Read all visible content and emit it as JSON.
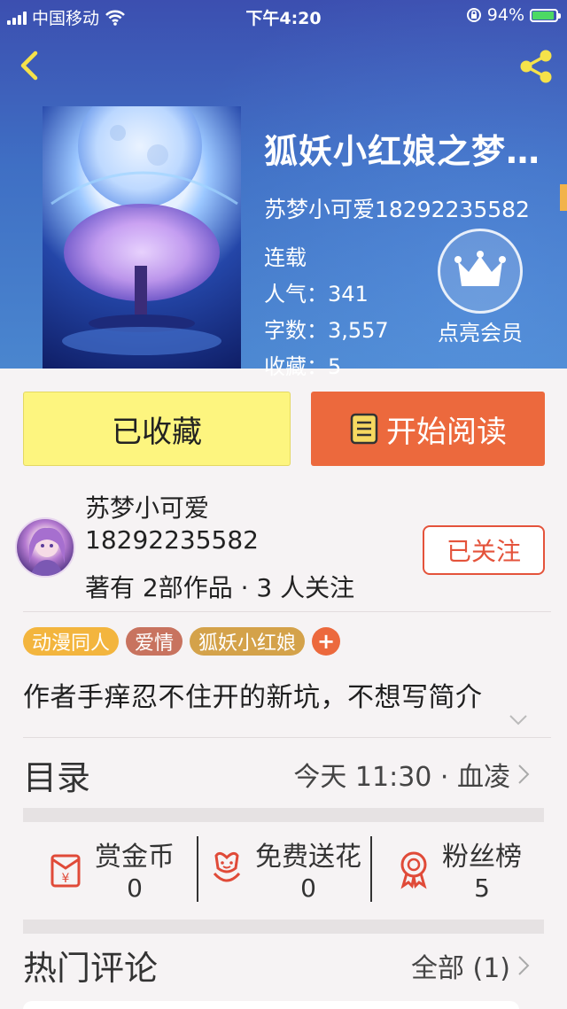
{
  "status_bar": {
    "carrier": "中国移动",
    "time": "下午4:20",
    "battery": "94%",
    "icons": [
      "signal-bars-icon",
      "wifi-icon",
      "orientation-lock-icon",
      "battery-charging-icon"
    ]
  },
  "header": {
    "back_icon": "chevron-left-icon",
    "share_icon": "share-icon",
    "accent": "#f2b34a"
  },
  "book": {
    "title": "狐妖小红娘之梦…",
    "author": "苏梦小可爱18292235582",
    "status": "连载",
    "popularity": "人气：341",
    "word_count": "字数：3,557",
    "favorites": "收藏：5"
  },
  "member": {
    "icon": "crown-icon",
    "label": "点亮会员"
  },
  "actions": {
    "favorited_label": "已收藏",
    "read_label": "开始阅读",
    "read_icon": "book-icon",
    "read_color": "#ec693d",
    "favorited_color": "#fdf57f"
  },
  "author_row": {
    "name_line1": "苏梦小可爱",
    "name_line2": "18292235582",
    "stats": "著有 2部作品 · 3 人关注",
    "follow_label": "已关注"
  },
  "tags": [
    {
      "label": "动漫同人",
      "color": "#f3b53e"
    },
    {
      "label": "爱情",
      "color": "#c8735f"
    },
    {
      "label": "狐妖小红娘",
      "color": "#d4a24a"
    }
  ],
  "tag_add": "+",
  "intro": "作者手痒忍不住开的新坑，不想写简介",
  "catalog": {
    "title": "目录",
    "latest": "今天 11:30 · 血凌"
  },
  "stats": [
    {
      "label": "赏金币",
      "value": "0",
      "icon": "red-envelope-icon"
    },
    {
      "label": "免费送花",
      "value": "0",
      "icon": "flower-icon"
    },
    {
      "label": "粉丝榜",
      "value": "5",
      "icon": "medal-icon"
    }
  ],
  "hot_comments": {
    "title": "热门评论",
    "all_label": "全部 (1)"
  }
}
